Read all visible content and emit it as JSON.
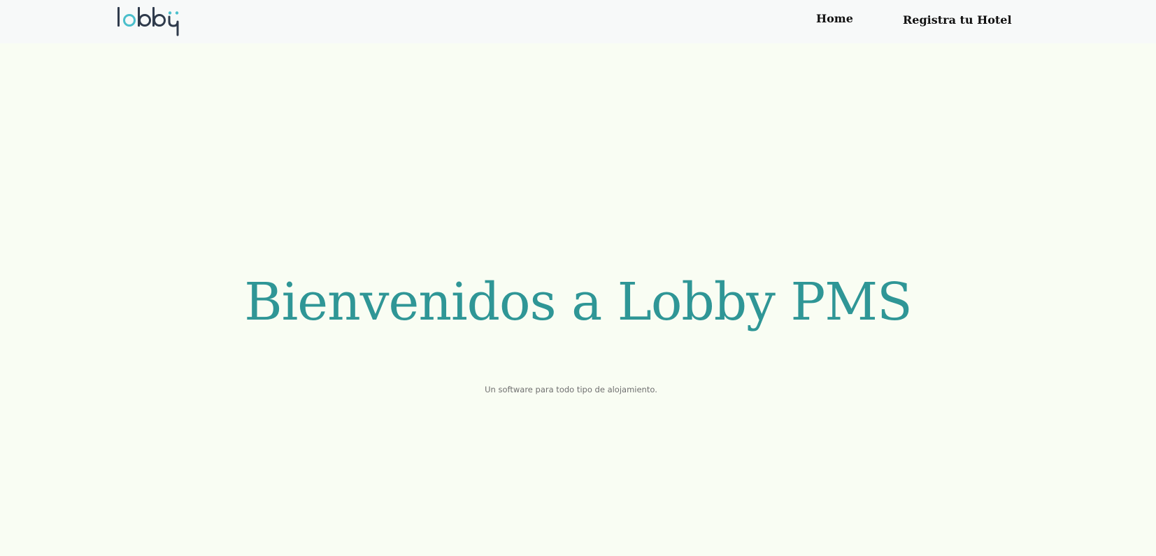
{
  "header": {
    "logo": {
      "text": "lobby",
      "icon": "lobby-logo",
      "colors": {
        "dark": "#2f3b4c",
        "accent": "#4bbfcc"
      }
    },
    "nav": {
      "home_label": "Home",
      "register_label": "Registra tu Hotel"
    }
  },
  "hero": {
    "title": "Bienvenidos a Lobby PMS",
    "subtitle": "Un software para todo tipo de alojamiento."
  },
  "colors": {
    "page_background": "#f9fdf3",
    "header_background": "#f7f9f9",
    "title": "#2f9696",
    "nav_text": "#111111",
    "subtitle": "#6f6f6f"
  }
}
